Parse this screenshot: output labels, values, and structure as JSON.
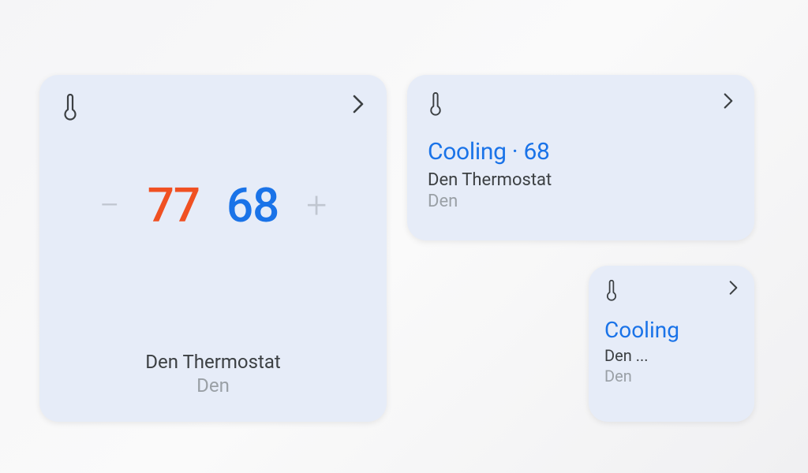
{
  "large": {
    "heat_temp": "77",
    "cool_temp": "68",
    "device_name": "Den Thermostat",
    "room": "Den",
    "minus": "−",
    "plus": "+"
  },
  "medium": {
    "status": "Cooling · 68",
    "device_name": "Den Thermostat",
    "room": "Den"
  },
  "small": {
    "status": "Cooling",
    "device_name": "Den ...",
    "room": "Den"
  }
}
